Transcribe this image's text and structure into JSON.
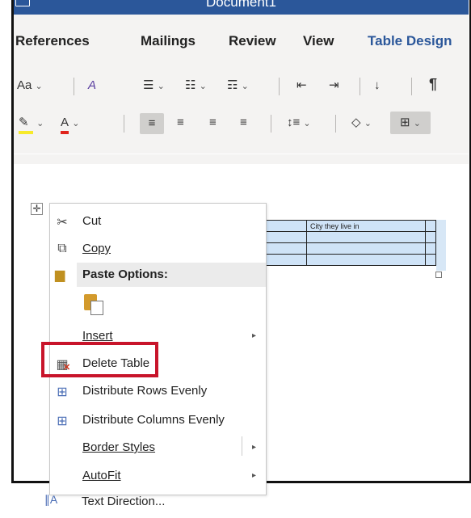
{
  "window": {
    "title": "Document1"
  },
  "tabs": [
    {
      "label": "References",
      "active": false
    },
    {
      "label": "Mailings",
      "active": false
    },
    {
      "label": "Review",
      "active": false
    },
    {
      "label": "View",
      "active": false
    },
    {
      "label": "Table Design",
      "active": true
    }
  ],
  "ribbon": {
    "row1": {
      "font_size_label": "Aa",
      "pilcrow": "¶"
    },
    "accent_color": "#2b579a",
    "highlight_color": "#f7ea2a",
    "font_color": "#e0231c"
  },
  "document": {
    "table": {
      "rows": [
        [
          "City they live in"
        ],
        [
          ""
        ],
        [
          ""
        ],
        [
          ""
        ]
      ]
    }
  },
  "context_menu": {
    "items": {
      "cut": "Cut",
      "copy": "Copy",
      "paste_options": "Paste Options:",
      "insert": "Insert",
      "delete_table": "Delete Table",
      "distribute_rows": "Distribute Rows Evenly",
      "distribute_columns": "Distribute Columns Evenly",
      "border_styles": "Border Styles",
      "autofit": "AutoFit",
      "text_direction": "Text Direction..."
    }
  },
  "annotation": {
    "color": "#c8142a"
  }
}
